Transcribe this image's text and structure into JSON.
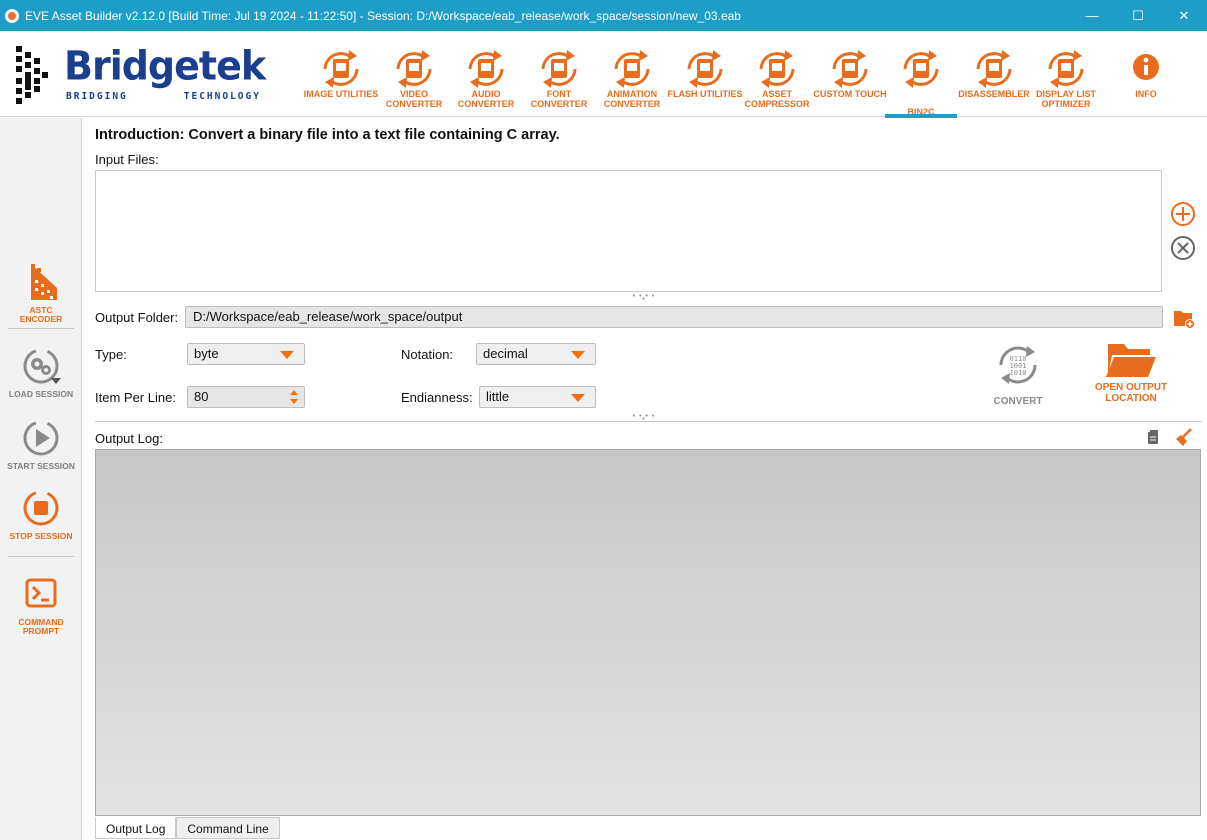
{
  "window": {
    "title": "EVE Asset Builder v2.12.0 [Build Time: Jul 19 2024 - 11:22:50] - Session: D:/Workspace/eab_release/work_space/session/new_03.eab",
    "controls": {
      "minimize": "—",
      "maximize": "☐",
      "close": "✕"
    }
  },
  "brand": {
    "name": "Bridgetek",
    "tagline_left": "BRIDGING",
    "tagline_right": "TECHNOLOGY"
  },
  "toolbar": [
    {
      "label": "IMAGE UTILITIES",
      "icon": "image-icon"
    },
    {
      "label": "VIDEO CONVERTER",
      "icon": "video-icon"
    },
    {
      "label": "AUDIO CONVERTER",
      "icon": "audio-icon"
    },
    {
      "label": "FONT CONVERTER",
      "icon": "font-icon"
    },
    {
      "label": "ANIMATION CONVERTER",
      "icon": "animation-icon"
    },
    {
      "label": "FLASH UTILITIES",
      "icon": "flash-icon"
    },
    {
      "label": "ASSET COMPRESSOR",
      "icon": "compressor-icon"
    },
    {
      "label": "CUSTOM TOUCH",
      "icon": "touch-icon"
    },
    {
      "label": "BIN2C",
      "icon": "bin2c-icon",
      "active": true
    },
    {
      "label": "DISASSEMBLER",
      "icon": "disassembler-icon"
    },
    {
      "label": "DISPLAY LIST OPTIMIZER",
      "icon": "optimizer-icon"
    },
    {
      "label": "INFO",
      "icon": "info-icon"
    }
  ],
  "sidebar": [
    {
      "label": "ASTC ENCODER",
      "icon": "astc-icon",
      "enabled": true
    },
    {
      "label": "LOAD SESSION",
      "icon": "load-session-icon",
      "enabled": false
    },
    {
      "label": "START SESSION",
      "icon": "start-session-icon",
      "enabled": false
    },
    {
      "label": "STOP SESSION",
      "icon": "stop-session-icon",
      "enabled": true
    },
    {
      "label": "COMMAND PROMPT",
      "icon": "command-prompt-icon",
      "enabled": true
    }
  ],
  "main": {
    "intro": "Introduction: Convert a binary file into a text file containing C array.",
    "input_files_label": "Input Files:",
    "output_folder_label": "Output Folder:",
    "output_folder_value": "D:/Workspace/eab_release/work_space/output",
    "type_label": "Type:",
    "type_value": "byte",
    "notation_label": "Notation:",
    "notation_value": "decimal",
    "item_per_line_label": "Item Per Line:",
    "item_per_line_value": "80",
    "endianness_label": "Endianness:",
    "endianness_value": "little",
    "convert_label": "CONVERT",
    "open_output_label": "OPEN OUTPUT LOCATION",
    "output_log_label": "Output Log:"
  },
  "tabs": [
    "Output Log",
    "Command Line"
  ],
  "colors": {
    "accent": "#e86c1e",
    "titlebar": "#1e9ec6",
    "brand": "#1b3f8f",
    "disabled": "#8a8a8a"
  }
}
